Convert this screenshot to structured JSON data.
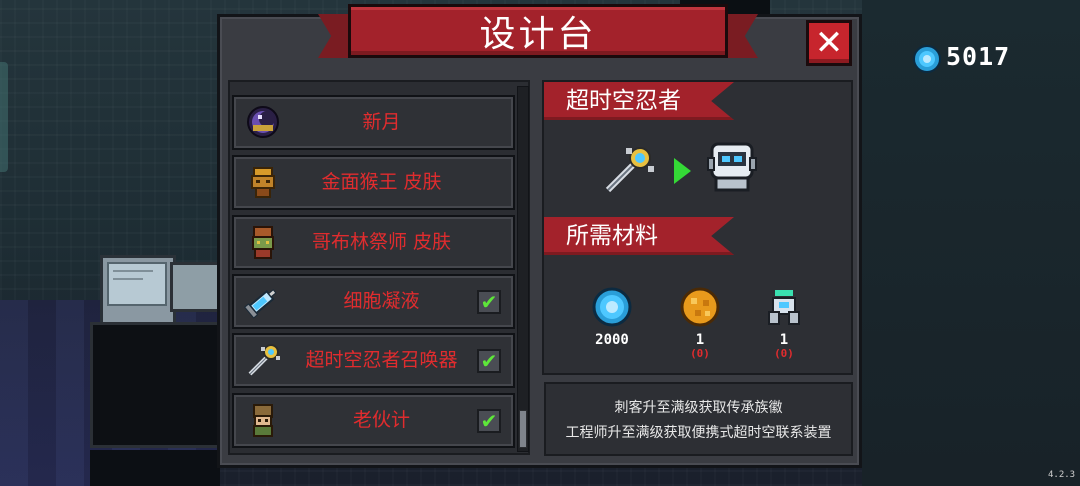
{
  "window": {
    "title": "设计台",
    "close_label": "✕"
  },
  "currency": {
    "icon": "blue-gem-icon",
    "value": "5017",
    "color": "#3ec3ff"
  },
  "blueprint_list": {
    "items": [
      {
        "label": "新月",
        "icon": "crescent-orb-icon",
        "checked": false
      },
      {
        "label": "金面猴王 皮肤",
        "icon": "monkey-king-skin-icon",
        "checked": false
      },
      {
        "label": "哥布林祭师 皮肤",
        "icon": "goblin-priest-skin-icon",
        "checked": false
      },
      {
        "label": "细胞凝液",
        "icon": "syringe-icon",
        "checked": true
      },
      {
        "label": "超时空忍者召唤器",
        "icon": "summoner-staff-icon",
        "checked": true
      },
      {
        "label": "老伙计",
        "icon": "old-buddy-icon",
        "checked": true
      }
    ],
    "check_mark": "✔"
  },
  "detail": {
    "name": "超时空忍者",
    "materials_header": "所需材料",
    "materials": [
      {
        "icon": "blue-gem-icon",
        "count": "2000",
        "need": ""
      },
      {
        "icon": "gold-ore-icon",
        "count": "1",
        "need": "(0)"
      },
      {
        "icon": "robot-part-icon",
        "count": "1",
        "need": "(0)"
      }
    ],
    "description_lines": [
      "刺客升至满级获取传承族徽",
      "工程师升至满级获取便携式超时空联系装置"
    ]
  },
  "version": "4.2.3",
  "colors": {
    "accent_red": "#a3222b",
    "list_text_red": "#e02c2e",
    "check_green": "#5ee63a",
    "arrow_green": "#34d936"
  }
}
